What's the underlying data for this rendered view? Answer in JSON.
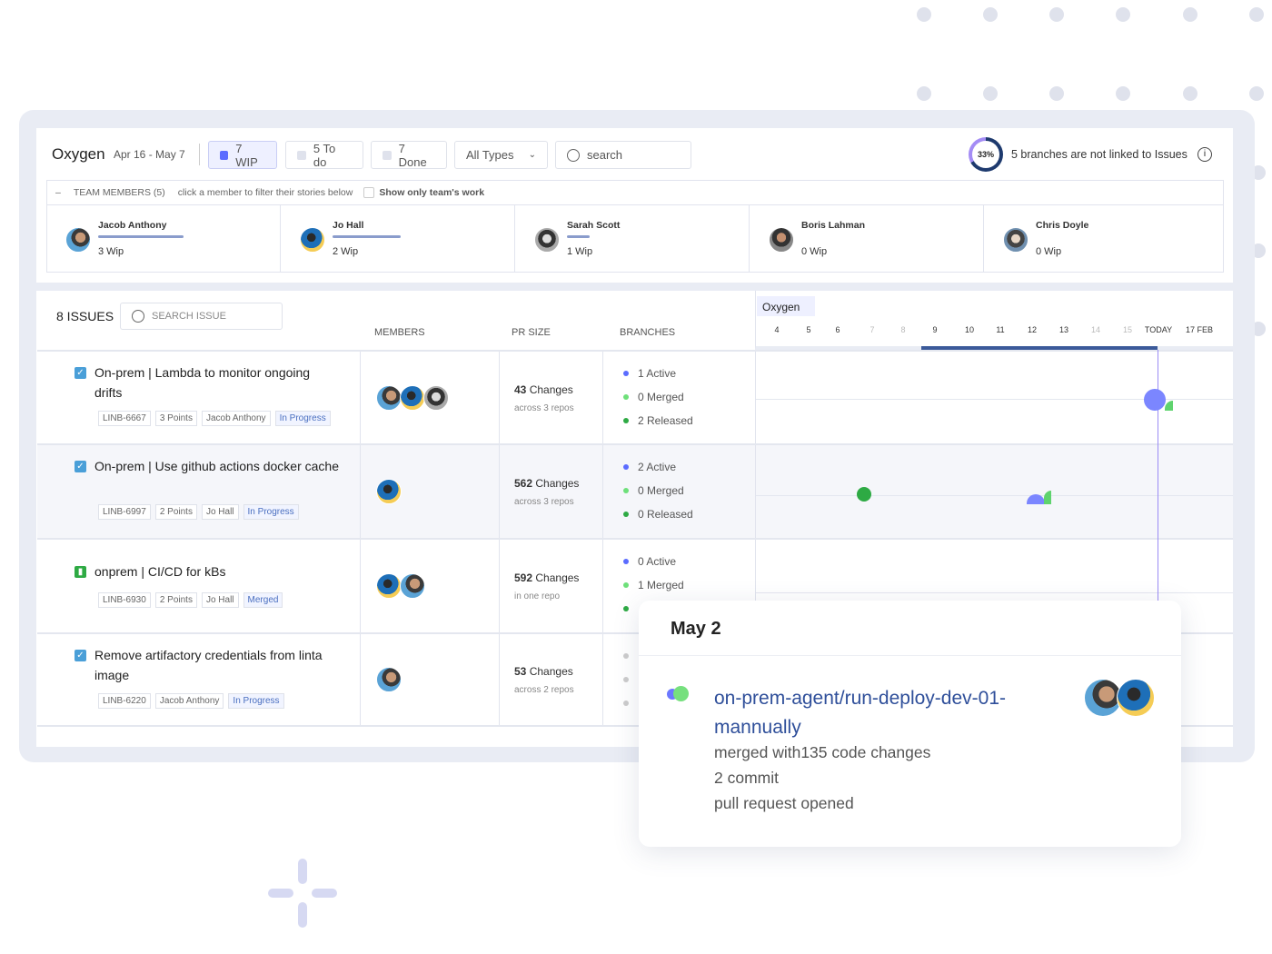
{
  "header": {
    "project": "Oxygen",
    "date_range": "Apr 16 - May 7",
    "filters": [
      {
        "label": "7 WIP",
        "active": true
      },
      {
        "label": "5 To do"
      },
      {
        "label": "7 Done"
      }
    ],
    "type_select": "All Types",
    "search_placeholder": "search",
    "progress_percent": "33%",
    "progress_value": 0.33,
    "unlinked_note": "5 branches are not linked to Issues"
  },
  "team": {
    "title": "TEAM MEMBERS (5)",
    "hint": "click a member to filter their stories below",
    "show_only": "Show only team's work",
    "members": [
      {
        "name": "Jacob Anthony",
        "wip": "3 Wip",
        "load": 0.75
      },
      {
        "name": "Jo Hall",
        "wip": "2 Wip",
        "load": 0.6
      },
      {
        "name": "Sarah Scott",
        "wip": "1 Wip",
        "load": 0.2
      },
      {
        "name": "Boris Lahman",
        "wip": "0 Wip",
        "load": 0
      },
      {
        "name": "Chris Doyle",
        "wip": "0 Wip",
        "load": 0
      }
    ]
  },
  "issues": {
    "count_label": "8 ISSUES",
    "search_placeholder": "SEARCH ISSUE",
    "columns": {
      "members": "MEMBERS",
      "pr": "PR SIZE",
      "branches": "BRANCHES"
    },
    "rows": [
      {
        "title": "On-prem | Lambda to monitor ongoing drifts",
        "type": "task",
        "tags": [
          "LINB-6667",
          "3 Points",
          "Jacob Anthony"
        ],
        "status": "In Progress",
        "avatars": [
          "a1",
          "a2",
          "a3"
        ],
        "changes": "43",
        "changes_label": "Changes",
        "repos": "across 3 repos",
        "branches": [
          "1 Active",
          "0 Merged",
          "2 Released"
        ]
      },
      {
        "title": "On-prem | Use github actions docker cache",
        "type": "task",
        "tags": [
          "LINB-6997",
          "2 Points",
          "Jo Hall"
        ],
        "status": "In Progress",
        "avatars": [
          "a2"
        ],
        "changes": "562",
        "changes_label": "Changes",
        "repos": "across 3 repos",
        "branches": [
          "2 Active",
          "0 Merged",
          "0 Released"
        ]
      },
      {
        "title": "onprem | CI/CD for kBs",
        "type": "story",
        "tags": [
          "LINB-6930",
          "2 Points",
          "Jo Hall"
        ],
        "status": "Merged",
        "avatars": [
          "a2",
          "a1"
        ],
        "changes": "592",
        "changes_label": "Changes",
        "repos": "in one repo",
        "branches": [
          "0 Active",
          "1 Merged",
          ""
        ]
      },
      {
        "title": "Remove artifactory credentials from linta image",
        "type": "task",
        "tags": [
          "LINB-6220",
          "Jacob Anthony"
        ],
        "status": "In Progress",
        "avatars": [
          "a1"
        ],
        "changes": "53",
        "changes_label": "Changes",
        "repos": "across 2 repos",
        "branches": [
          "",
          "",
          ""
        ]
      }
    ]
  },
  "timeline": {
    "label": "Oxygen",
    "ticks": [
      "4",
      "5",
      "6",
      "7",
      "8",
      "9",
      "10",
      "11",
      "12",
      "13",
      "14",
      "15",
      "TODAY",
      "17 FEB"
    ],
    "muted_ticks": [
      "7",
      "8",
      "14",
      "15"
    ]
  },
  "popup": {
    "date": "May 2",
    "branch": "on-prem-agent/run-deploy-dev-01-mannually",
    "lines": [
      "merged with135 code changes",
      "2 commit",
      "pull request opened"
    ]
  },
  "colors": {
    "accent": "#5b6cff",
    "active": "#5b6cff",
    "merged": "#6ee07a",
    "released": "#2eaa44",
    "link": "#2f4f9a"
  }
}
